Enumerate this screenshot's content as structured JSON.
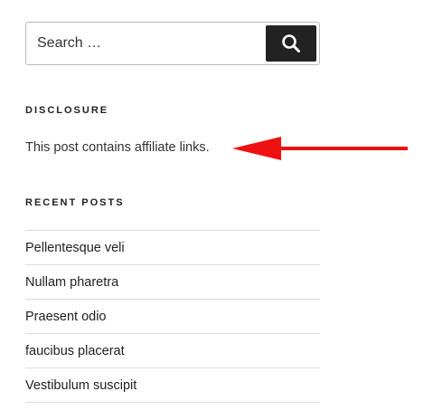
{
  "search": {
    "value": "Search …",
    "button_icon": "search-icon"
  },
  "disclosure": {
    "title": "DISCLOSURE",
    "text": "This post contains affiliate links."
  },
  "annotation": {
    "arrow_color": "#ee1111"
  },
  "recent_posts": {
    "title": "RECENT POSTS",
    "items": [
      {
        "label": "Pellentesque veli"
      },
      {
        "label": "Nullam pharetra"
      },
      {
        "label": "Praesent odio"
      },
      {
        "label": "faucibus placerat"
      },
      {
        "label": "Vestibulum suscipit"
      }
    ]
  }
}
